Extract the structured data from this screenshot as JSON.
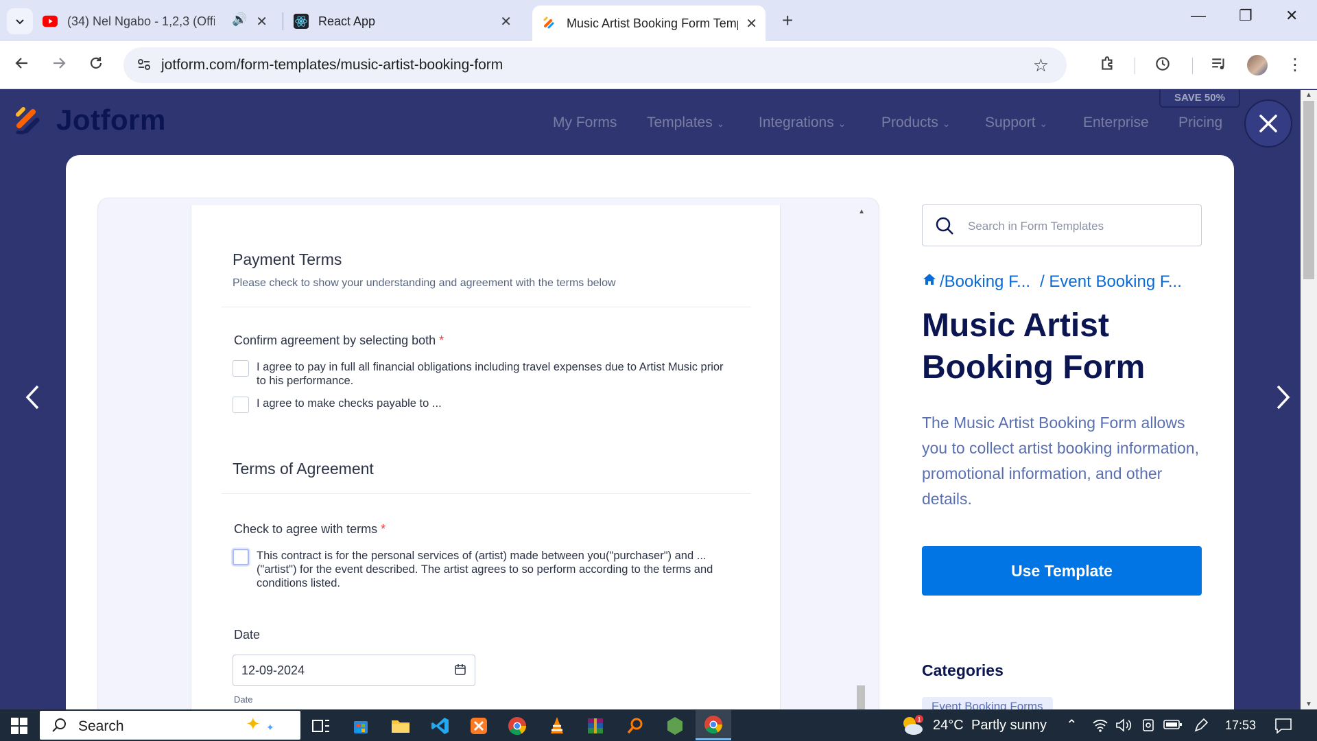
{
  "browser": {
    "tabs": [
      {
        "title": "(34) Nel Ngabo - 1,2,3 (Offic",
        "icon": "youtube-icon"
      },
      {
        "title": "React App",
        "icon": "react-icon"
      },
      {
        "title": "Music Artist Booking Form Temp",
        "icon": "jotform-icon"
      }
    ],
    "url": "jotform.com/form-templates/music-artist-booking-form"
  },
  "site": {
    "logo_text": "Jotform",
    "nav": [
      "My Forms",
      "Templates",
      "Integrations",
      "Products",
      "Support",
      "Enterprise",
      "Pricing"
    ],
    "save_badge": "SAVE 50%"
  },
  "form": {
    "payment_title": "Payment Terms",
    "payment_sub": "Please check to show your understanding and agreement with the terms below",
    "q1_label": "Confirm agreement by selecting both",
    "q1_options": [
      "I agree to pay in full all financial obligations including travel expenses due to Artist Music prior to his performance.",
      "I agree to make checks payable to ..."
    ],
    "terms_title": "Terms of Agreement",
    "q2_label": "Check to agree with terms",
    "q2_option": "This contract is for the personal services of (artist) made between you(\"purchaser\") and ... (\"artist\") for the event described. The artist agrees to so perform according to the terms and conditions listed.",
    "required_mark": "*",
    "date_label": "Date",
    "date_value": "12-09-2024",
    "date_sublabel": "Date"
  },
  "panel": {
    "search_placeholder": "Search in Form Templates",
    "breadcrumb": [
      "/Booking F...",
      "/ Event Booking F..."
    ],
    "title": "Music Artist Booking Form",
    "description": "The Music Artist Booking Form allows you to collect artist booking information, promotional information, and other details.",
    "use_button": "Use Template",
    "categories_title": "Categories",
    "category_chip": "Event Booking Forms"
  },
  "taskbar": {
    "search_label": "Search",
    "weather_temp": "24°C",
    "weather_text": "Partly sunny",
    "time": "17:53"
  },
  "colors": {
    "brand_navy": "#0a1551",
    "primary_blue": "#0075e3",
    "header_bg": "#2f3570"
  }
}
